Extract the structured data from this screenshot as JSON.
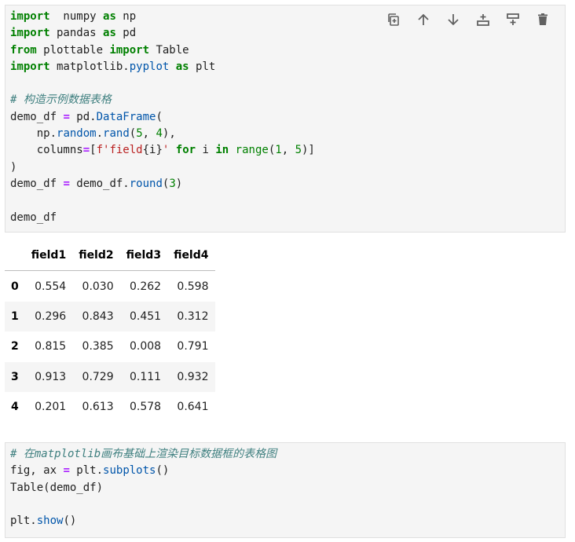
{
  "toolbar": {
    "icons": [
      "duplicate-icon",
      "move-up-icon",
      "move-down-icon",
      "insert-above-icon",
      "insert-below-icon",
      "delete-icon"
    ]
  },
  "cell1": {
    "lines": [
      [
        [
          "kw",
          "import"
        ],
        [
          "",
          "  numpy "
        ],
        [
          "kw",
          "as"
        ],
        [
          "",
          " np"
        ]
      ],
      [
        [
          "kw",
          "import"
        ],
        [
          "",
          ""
        ],
        [
          "",
          " pandas "
        ],
        [
          "kw",
          "as"
        ],
        [
          "",
          " pd"
        ]
      ],
      [
        [
          "kw",
          "from"
        ],
        [
          "",
          " plottable "
        ],
        [
          "kw",
          "import"
        ],
        [
          "",
          " Table"
        ]
      ],
      [
        [
          "kw",
          "import"
        ],
        [
          "",
          " matplotlib."
        ],
        [
          "fn",
          "pyplot"
        ],
        [
          "",
          " "
        ],
        [
          "kw",
          "as"
        ],
        [
          "",
          " plt"
        ]
      ],
      [],
      [
        [
          "cm",
          "# 构造示例数据表格"
        ]
      ],
      [
        [
          "",
          "demo_df "
        ],
        [
          "op",
          "="
        ],
        [
          "",
          " pd."
        ],
        [
          "fn",
          "DataFrame"
        ],
        [
          "",
          "("
        ]
      ],
      [
        [
          "",
          "    np."
        ],
        [
          "fn",
          "random"
        ],
        [
          "",
          "."
        ],
        [
          "fn",
          "rand"
        ],
        [
          "",
          "("
        ],
        [
          "num",
          "5"
        ],
        [
          "",
          ", "
        ],
        [
          "num",
          "4"
        ],
        [
          "",
          "),"
        ]
      ],
      [
        [
          "",
          "    columns"
        ],
        [
          "op",
          "="
        ],
        [
          "",
          "["
        ],
        [
          "str",
          "f'field"
        ],
        [
          "",
          "{i}"
        ],
        [
          "str",
          "'"
        ],
        [
          "",
          " "
        ],
        [
          "kw",
          "for"
        ],
        [
          "",
          " i "
        ],
        [
          "kw",
          "in"
        ],
        [
          "",
          " "
        ],
        [
          "num",
          "range"
        ],
        [
          "",
          "("
        ],
        [
          "num",
          "1"
        ],
        [
          "",
          ", "
        ],
        [
          "num",
          "5"
        ],
        [
          "",
          ")]"
        ]
      ],
      [
        [
          "",
          ")"
        ]
      ],
      [
        [
          "",
          "demo_df "
        ],
        [
          "op",
          "="
        ],
        [
          "",
          " demo_df."
        ],
        [
          "fn",
          "round"
        ],
        [
          "",
          "("
        ],
        [
          "num",
          "3"
        ],
        [
          "",
          ")"
        ]
      ],
      [],
      [
        [
          "",
          "demo_df"
        ]
      ]
    ]
  },
  "table": {
    "columns": [
      "field1",
      "field2",
      "field3",
      "field4"
    ],
    "rows": [
      {
        "index": "0",
        "values": [
          "0.554",
          "0.030",
          "0.262",
          "0.598"
        ]
      },
      {
        "index": "1",
        "values": [
          "0.296",
          "0.843",
          "0.451",
          "0.312"
        ]
      },
      {
        "index": "2",
        "values": [
          "0.815",
          "0.385",
          "0.008",
          "0.791"
        ]
      },
      {
        "index": "3",
        "values": [
          "0.913",
          "0.729",
          "0.111",
          "0.932"
        ]
      },
      {
        "index": "4",
        "values": [
          "0.201",
          "0.613",
          "0.578",
          "0.641"
        ]
      }
    ]
  },
  "cell2": {
    "lines": [
      [
        [
          "cm",
          "# 在matplotlib画布基础上渲染目标数据框的表格图"
        ]
      ],
      [
        [
          "",
          "fig, ax "
        ],
        [
          "op",
          "="
        ],
        [
          "",
          " plt."
        ],
        [
          "fn",
          "subplots"
        ],
        [
          "",
          "()"
        ]
      ],
      [
        [
          "",
          "Table(demo_df)"
        ]
      ],
      [],
      [
        [
          "",
          "plt."
        ],
        [
          "fn",
          "show"
        ],
        [
          "",
          "()"
        ]
      ]
    ]
  }
}
